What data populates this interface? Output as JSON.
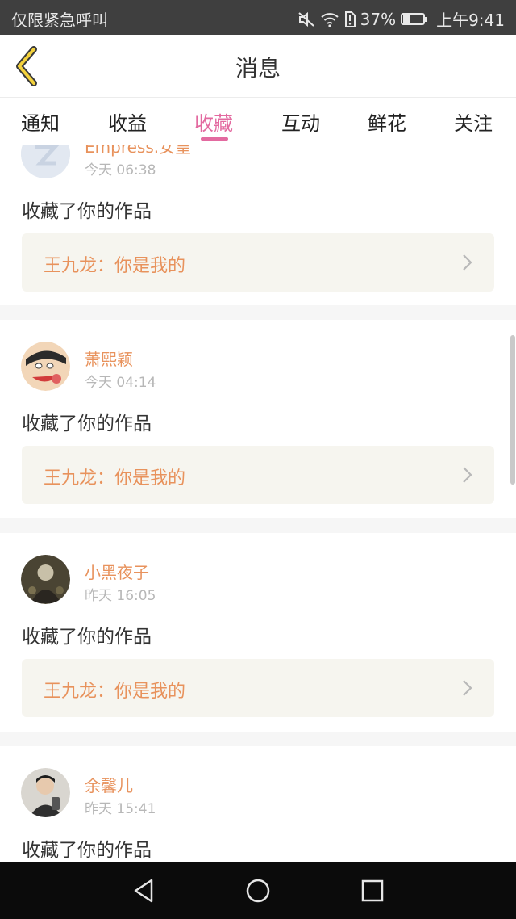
{
  "status_bar": {
    "carrier_text": "仅限紧急呼叫",
    "battery_percent": "37%",
    "battery_level": 0.37,
    "time": "上午9:41",
    "icons": [
      "mute-icon",
      "wifi-icon",
      "sim-alert-icon",
      "battery-icon"
    ]
  },
  "header": {
    "title": "消息",
    "back_icon": "chevron-left-icon"
  },
  "tabs": {
    "items": [
      {
        "label": "通知"
      },
      {
        "label": "收益"
      },
      {
        "label": "收藏"
      },
      {
        "label": "互动"
      },
      {
        "label": "鲜花"
      },
      {
        "label": "关注"
      }
    ],
    "active": "收藏"
  },
  "messages": [
    {
      "name": "Empress.女皇",
      "time": "今天 06:38",
      "action": "收藏了你的作品",
      "work": "王九龙：你是我的"
    },
    {
      "name": "萧熙颖",
      "time": "今天 04:14",
      "action": "收藏了你的作品",
      "work": "王九龙：你是我的"
    },
    {
      "name": "小黑夜子",
      "time": "昨天 16:05",
      "action": "收藏了你的作品",
      "work": "王九龙：你是我的"
    },
    {
      "name": "余馨儿",
      "time": "昨天 15:41",
      "action": "收藏了你的作品",
      "work": ""
    }
  ],
  "colors": {
    "accent": "#e36aa0",
    "username": "#e8925c",
    "work_bg": "#f6f5ef"
  },
  "navbar": {
    "buttons": [
      "back-triangle-icon",
      "home-circle-icon",
      "recents-square-icon"
    ]
  }
}
